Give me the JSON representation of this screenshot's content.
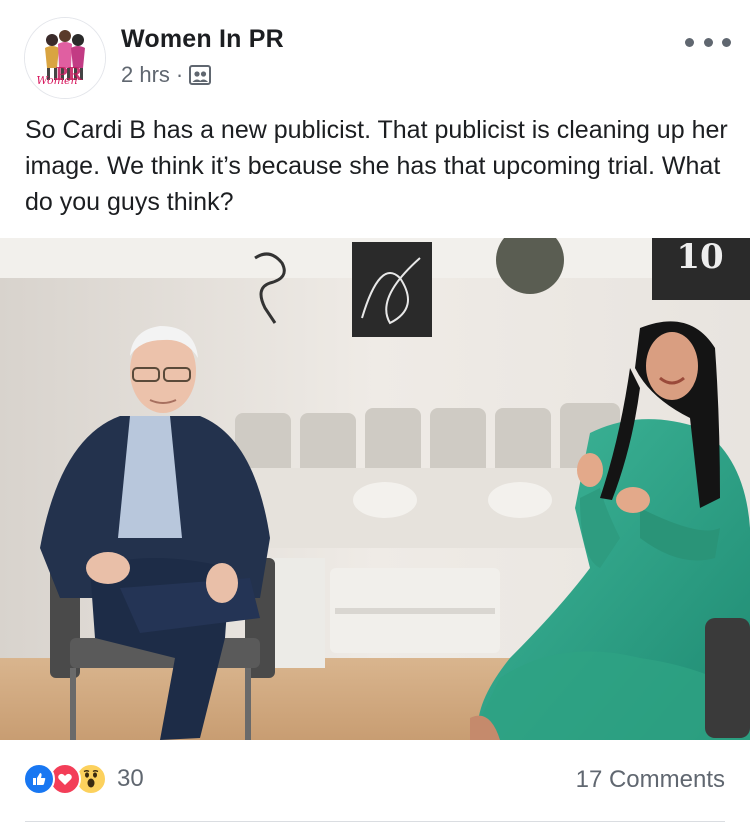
{
  "post": {
    "page_name": "Women In PR",
    "timestamp": "2 hrs",
    "separator": "·",
    "audience_icon": "public-group-icon",
    "avatar_text": "Women",
    "text": "So Cardi B has a new publicist. That publicist is cleaning up her image. We think it’s because she has that upcoming trial. What do you guys think?",
    "photo_sign_text": "10"
  },
  "reactions": {
    "icons": [
      "like-icon",
      "love-icon",
      "wow-icon"
    ],
    "count": "30"
  },
  "comments": {
    "label": "17 Comments"
  },
  "colors": {
    "like": "#1877f2",
    "love": "#f33e58",
    "wow": "#fcd15d",
    "meta_text": "#606770"
  }
}
